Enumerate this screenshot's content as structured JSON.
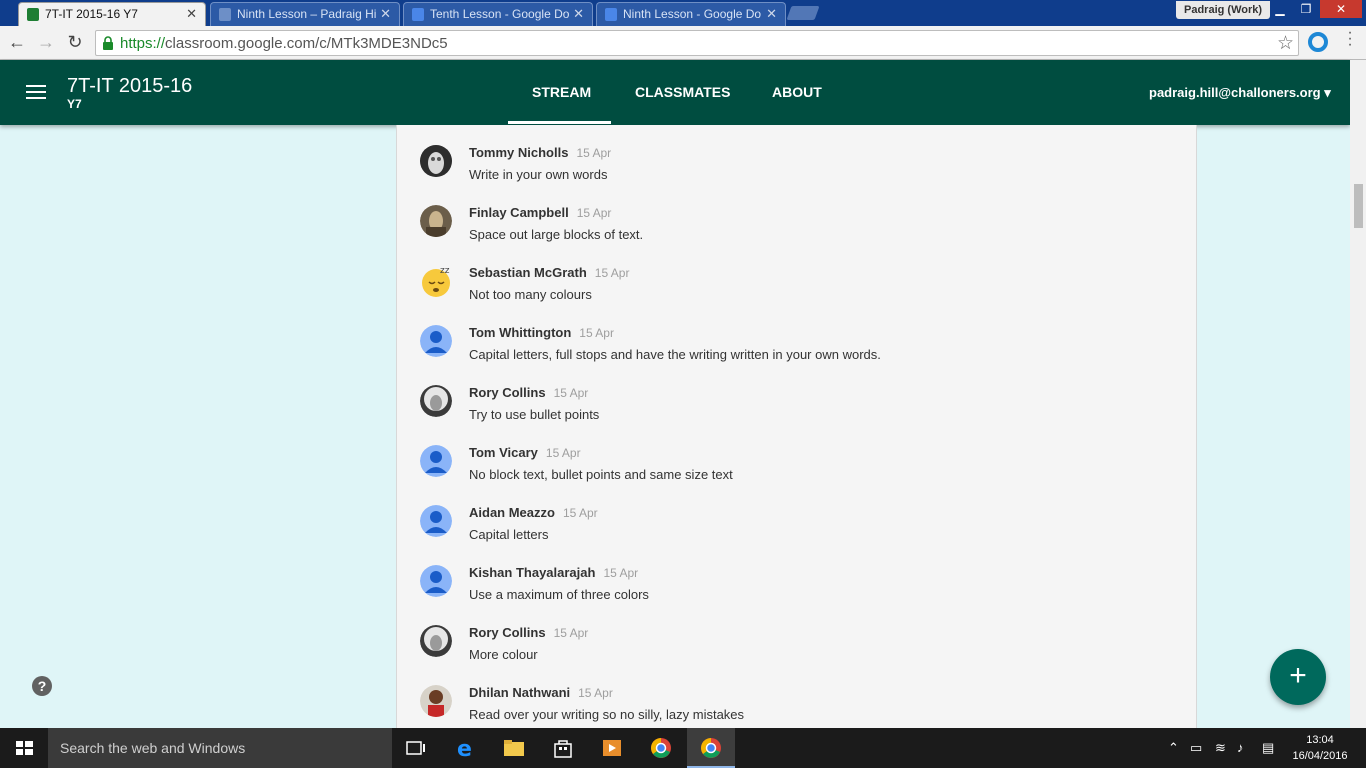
{
  "browser": {
    "tabs": [
      {
        "title": "7T-IT 2015-16 Y7",
        "active": true,
        "icon_color": "#1e7e34"
      },
      {
        "title": "Ninth Lesson – Padraig Hi",
        "active": false,
        "icon_color": "#6d8fc7"
      },
      {
        "title": "Tenth Lesson - Google Do",
        "active": false,
        "icon_color": "#4a86e8"
      },
      {
        "title": "Ninth Lesson - Google Do",
        "active": false,
        "icon_color": "#4a86e8"
      }
    ],
    "profile": "Padraig (Work)",
    "url_scheme": "https://",
    "url_rest": "classroom.google.com/c/MTk3MDE3NDc5"
  },
  "classroom": {
    "class_name": "7T-IT 2015-16",
    "section": "Y7",
    "nav": {
      "stream": "STREAM",
      "classmates": "CLASSMATES",
      "about": "ABOUT"
    },
    "account": "padraig.hill@challoners.org",
    "header_color": "#004d40",
    "background_color": "#dff5f7"
  },
  "comments": [
    {
      "author": "Tommy Nicholls",
      "date": "15 Apr",
      "text": "Write in your own words",
      "avatar": "photo-robot"
    },
    {
      "author": "Finlay Campbell",
      "date": "15 Apr",
      "text": "Space out large blocks of text.",
      "avatar": "photo-general"
    },
    {
      "author": "Sebastian McGrath",
      "date": "15 Apr",
      "text": "Not too many colours",
      "avatar": "sleepy-emoji"
    },
    {
      "author": "Tom Whittington",
      "date": "15 Apr",
      "text": "Capital letters, full stops and have the writing written in your own words.",
      "avatar": "default-person"
    },
    {
      "author": "Rory Collins",
      "date": "15 Apr",
      "text": "Try to use bullet points",
      "avatar": "photo-einstein"
    },
    {
      "author": "Tom Vicary",
      "date": "15 Apr",
      "text": "No block text, bullet points and same size text",
      "avatar": "default-person"
    },
    {
      "author": "Aidan Meazzo",
      "date": "15 Apr",
      "text": "Capital letters",
      "avatar": "default-person"
    },
    {
      "author": "Kishan Thayalarajah",
      "date": "15 Apr",
      "text": "Use a maximum of three colors",
      "avatar": "default-person"
    },
    {
      "author": "Rory Collins",
      "date": "15 Apr",
      "text": "More colour",
      "avatar": "photo-einstein"
    },
    {
      "author": "Dhilan Nathwani",
      "date": "15 Apr",
      "text": "Read over your writing so no silly, lazy mistakes",
      "avatar": "photo-child"
    }
  ],
  "taskbar": {
    "search_placeholder": "Search the web and Windows",
    "time": "13:04",
    "date": "16/04/2016"
  }
}
